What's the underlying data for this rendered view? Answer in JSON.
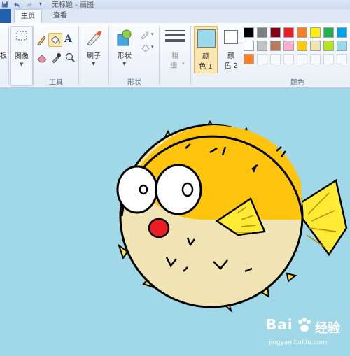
{
  "window": {
    "title": "无标题 - 画图"
  },
  "tabs": [
    {
      "label": "主页"
    },
    {
      "label": "查看"
    }
  ],
  "ribbon": {
    "partial_label_left": "板",
    "image_label": "图像",
    "tools_group_label": "工具",
    "brushes_label": "刷子",
    "shapes_label": "形状",
    "shapes_group_label": "形状",
    "size_label_line1": "粗",
    "size_label_line2": "细",
    "color1_label_line1": "颜",
    "color1_label_line2": "色 1",
    "color2_label_line1": "颜",
    "color2_label_line2": "色 2",
    "colors_group_label": "颜色"
  },
  "colors": {
    "accent_selected": "#fbe6b0",
    "color1": "#99d9ea",
    "color2": "#ffffff",
    "canvas_bg": "#a0d8e8"
  },
  "palette": {
    "row1": [
      "#000000",
      "#7f7f7f",
      "#880015",
      "#ed1c24",
      "#ff7f27",
      "#fff200",
      "#22b14c",
      "#00a2e8"
    ],
    "row2": [
      "#ffffff",
      "#c3c3c3",
      "#b97a57",
      "#ffaec9",
      "#ffc90e",
      "#efe4b0",
      "#b5e61d",
      "#99d9ea"
    ],
    "row3": [
      "#ff7f27",
      "",
      "",
      "",
      "",
      "",
      "",
      ""
    ]
  },
  "watermark": {
    "brand": "Bai",
    "brand_cn": "经验",
    "url": "jingyan.baidu.com"
  },
  "icons": [
    "save-icon",
    "undo-icon",
    "redo-icon",
    "quick-access-dropdown-icon",
    "select-icon",
    "pencil-icon",
    "fill-icon",
    "text-icon",
    "eraser-icon",
    "color-picker-icon",
    "magnifier-icon",
    "brush-icon",
    "shapes-icon",
    "outline-icon",
    "fill-shape-icon",
    "size-lines-icon"
  ]
}
